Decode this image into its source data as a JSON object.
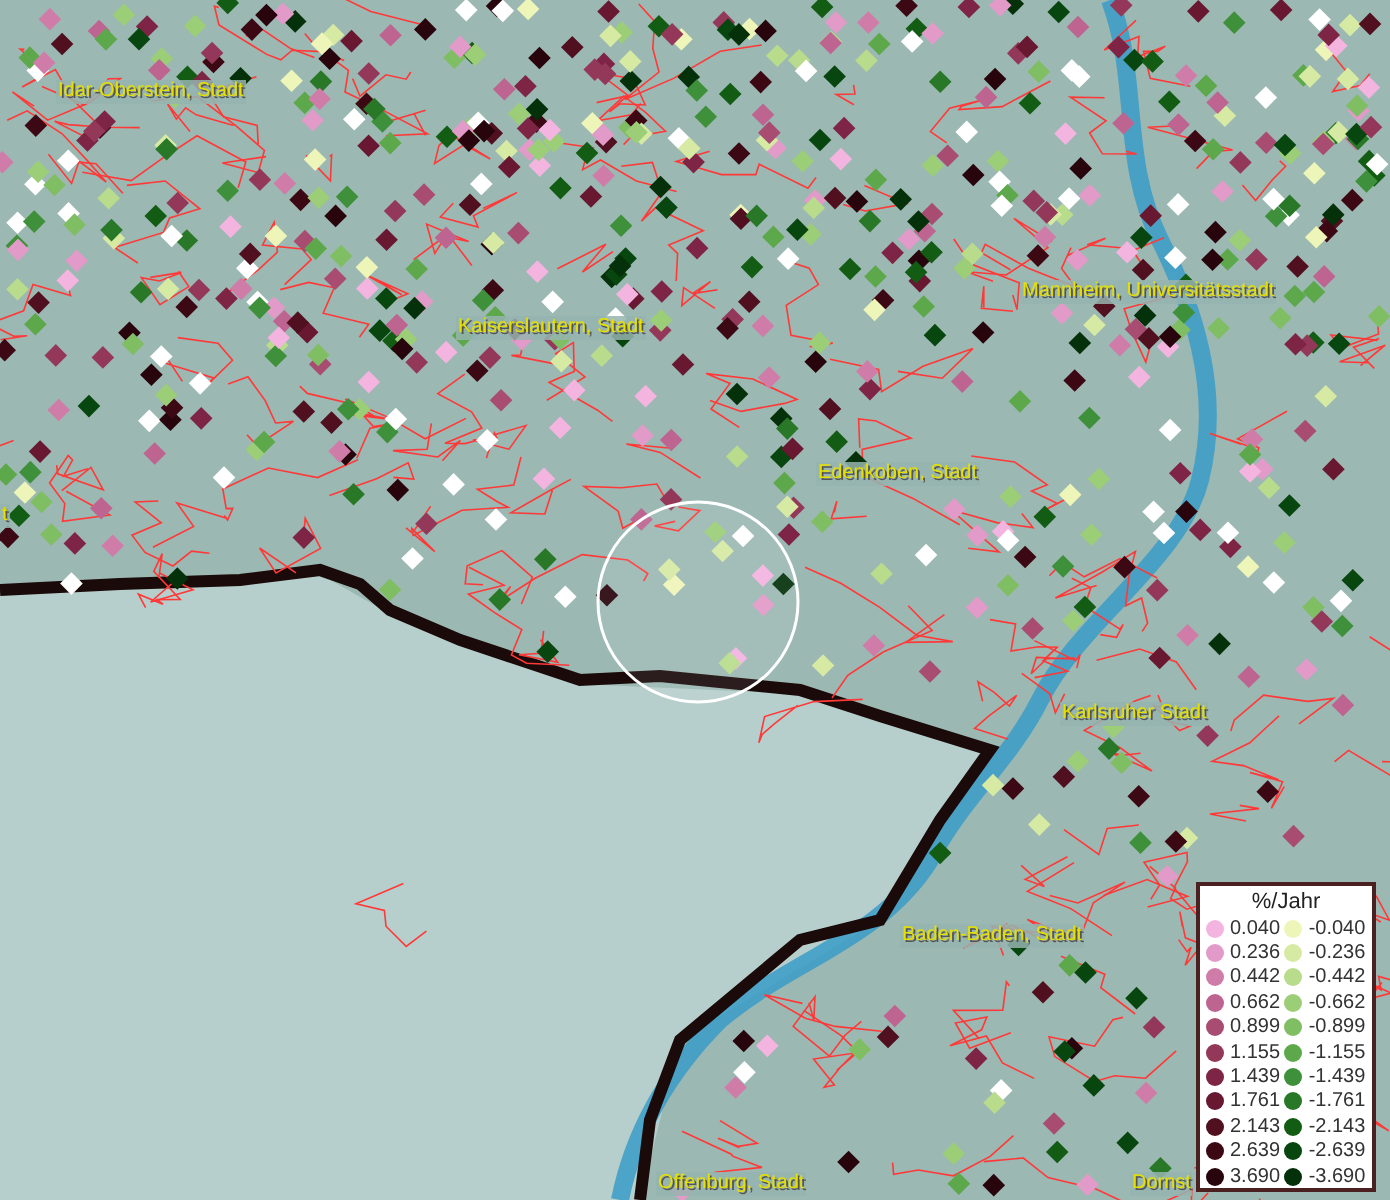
{
  "map": {
    "places": [
      {
        "name": "Idar-Oberstein, Stadt"
      },
      {
        "name": "Kaiserslautern, Stadt"
      },
      {
        "name": "Mannheim, Universitätsstadt"
      },
      {
        "name": "t"
      },
      {
        "name": "Edenkoben, Stadt"
      },
      {
        "name": "Karlsruher Stadt"
      },
      {
        "name": "Baden-Baden, Stadt"
      },
      {
        "name": "Offenburg, Stadt"
      },
      {
        "name": "Dornst"
      }
    ]
  },
  "legend": {
    "title": "%/Jahr",
    "positive": [
      {
        "label": "0.040",
        "color": "#f4b4e0"
      },
      {
        "label": "0.236",
        "color": "#e29ac8"
      },
      {
        "label": "0.442",
        "color": "#cf7ca8"
      },
      {
        "label": "0.662",
        "color": "#bd6490"
      },
      {
        "label": "0.899",
        "color": "#a84c72"
      },
      {
        "label": "1.155",
        "color": "#94385a"
      },
      {
        "label": "1.439",
        "color": "#7e2444"
      },
      {
        "label": "1.761",
        "color": "#681830"
      },
      {
        "label": "2.143",
        "color": "#501020"
      },
      {
        "label": "2.639",
        "color": "#3c0814"
      },
      {
        "label": "3.690",
        "color": "#28040c"
      }
    ],
    "negative": [
      {
        "label": "-0.040",
        "color": "#eef5b8"
      },
      {
        "label": "-0.236",
        "color": "#d6eaa4"
      },
      {
        "label": "-0.442",
        "color": "#b8dc8c"
      },
      {
        "label": "-0.662",
        "color": "#9cce78"
      },
      {
        "label": "-0.899",
        "color": "#80be64"
      },
      {
        "label": "-1.155",
        "color": "#5ea84c"
      },
      {
        "label": "-1.439",
        "color": "#3e903a"
      },
      {
        "label": "-1.761",
        "color": "#287828"
      },
      {
        "label": "-2.143",
        "color": "#125c14"
      },
      {
        "label": "-2.639",
        "color": "#084610"
      },
      {
        "label": "-3.690",
        "color": "#04300a"
      }
    ]
  }
}
